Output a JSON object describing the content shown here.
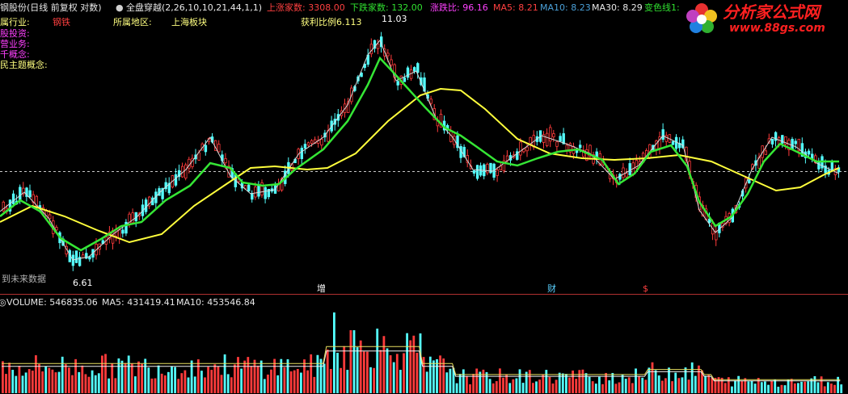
{
  "header": {
    "stock_title": "钢股份(日线 前复权 对数)",
    "indicator_dot": "●",
    "indicator": "全盘穿越(2,26,10,10,21,44,1,1)",
    "up_count_label": "上涨家数: 3308.00",
    "down_count_label": "下跌家数: 132.00",
    "ratio_label": "涨跌比: 96.16",
    "ma5_label": "MA5: 8.21",
    "ma10_label": "MA10: 8.23",
    "ma30_label": "MA30: 8.29",
    "change_line_label": "变色线1:"
  },
  "info": {
    "industry_label": "属行业:",
    "industry_value": "钢铁",
    "region_label": "所属地区:",
    "region_value": "上海板块",
    "profit_ratio": "获利比例6.113",
    "invest_label": "股投资:",
    "business_label": "营业务:",
    "concept_label": "千概念:",
    "theme_label": "民主题概念:"
  },
  "price_labels": {
    "high": "11.03",
    "low": "6.61",
    "future_note": "到未来数据"
  },
  "markers": {
    "zeng": "增",
    "cai": "财",
    "dollar": "$"
  },
  "volume": {
    "label": "VOLUME: 546835.06",
    "ma5": "MA5: 431419.41",
    "ma10": "MA10: 453546.84",
    "toggle": "◎"
  },
  "logo": {
    "name": "分析家公式网",
    "url": "www.88gs.com"
  },
  "colors": {
    "background": "#000000",
    "up_candle": "#ff3b3b",
    "down_candle": "#54ffff",
    "ma_yellow": "#ffff3c",
    "ma_green": "#35e635",
    "thin_line": "#d8d8d8",
    "dashed_line": "#c8c8c8",
    "header_red": "#ff4040",
    "header_green": "#30e030",
    "header_magenta": "#ff40ff",
    "header_blue": "#4aa0d8",
    "label_yellow": "#ffff80",
    "label_magenta": "#ff40ff"
  }
}
